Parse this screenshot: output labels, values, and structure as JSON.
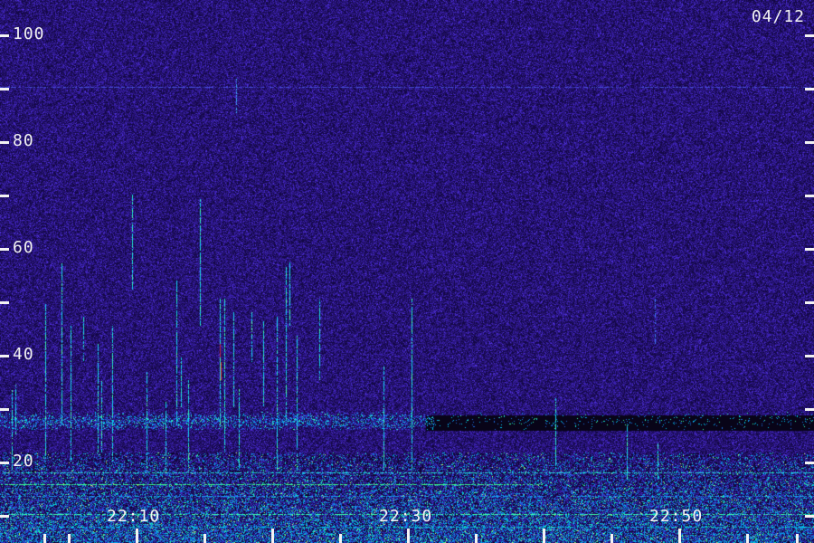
{
  "date": "04/12",
  "y_axis": {
    "labels": [
      "100",
      "80",
      "60",
      "40",
      "20"
    ],
    "range": [
      0,
      100
    ],
    "major_step": 20,
    "minor_step": 10
  },
  "x_axis": {
    "labels": [
      "22:10",
      "22:30",
      "22:50"
    ]
  },
  "colors": {
    "background": "#1a0d55",
    "noise_low": "#2a1a80",
    "noise_high": "#4a30d0",
    "signal": "#00e0ff",
    "strong": "#40ff90",
    "peak": "#ff4020",
    "labels": "#f2f2f2"
  }
}
